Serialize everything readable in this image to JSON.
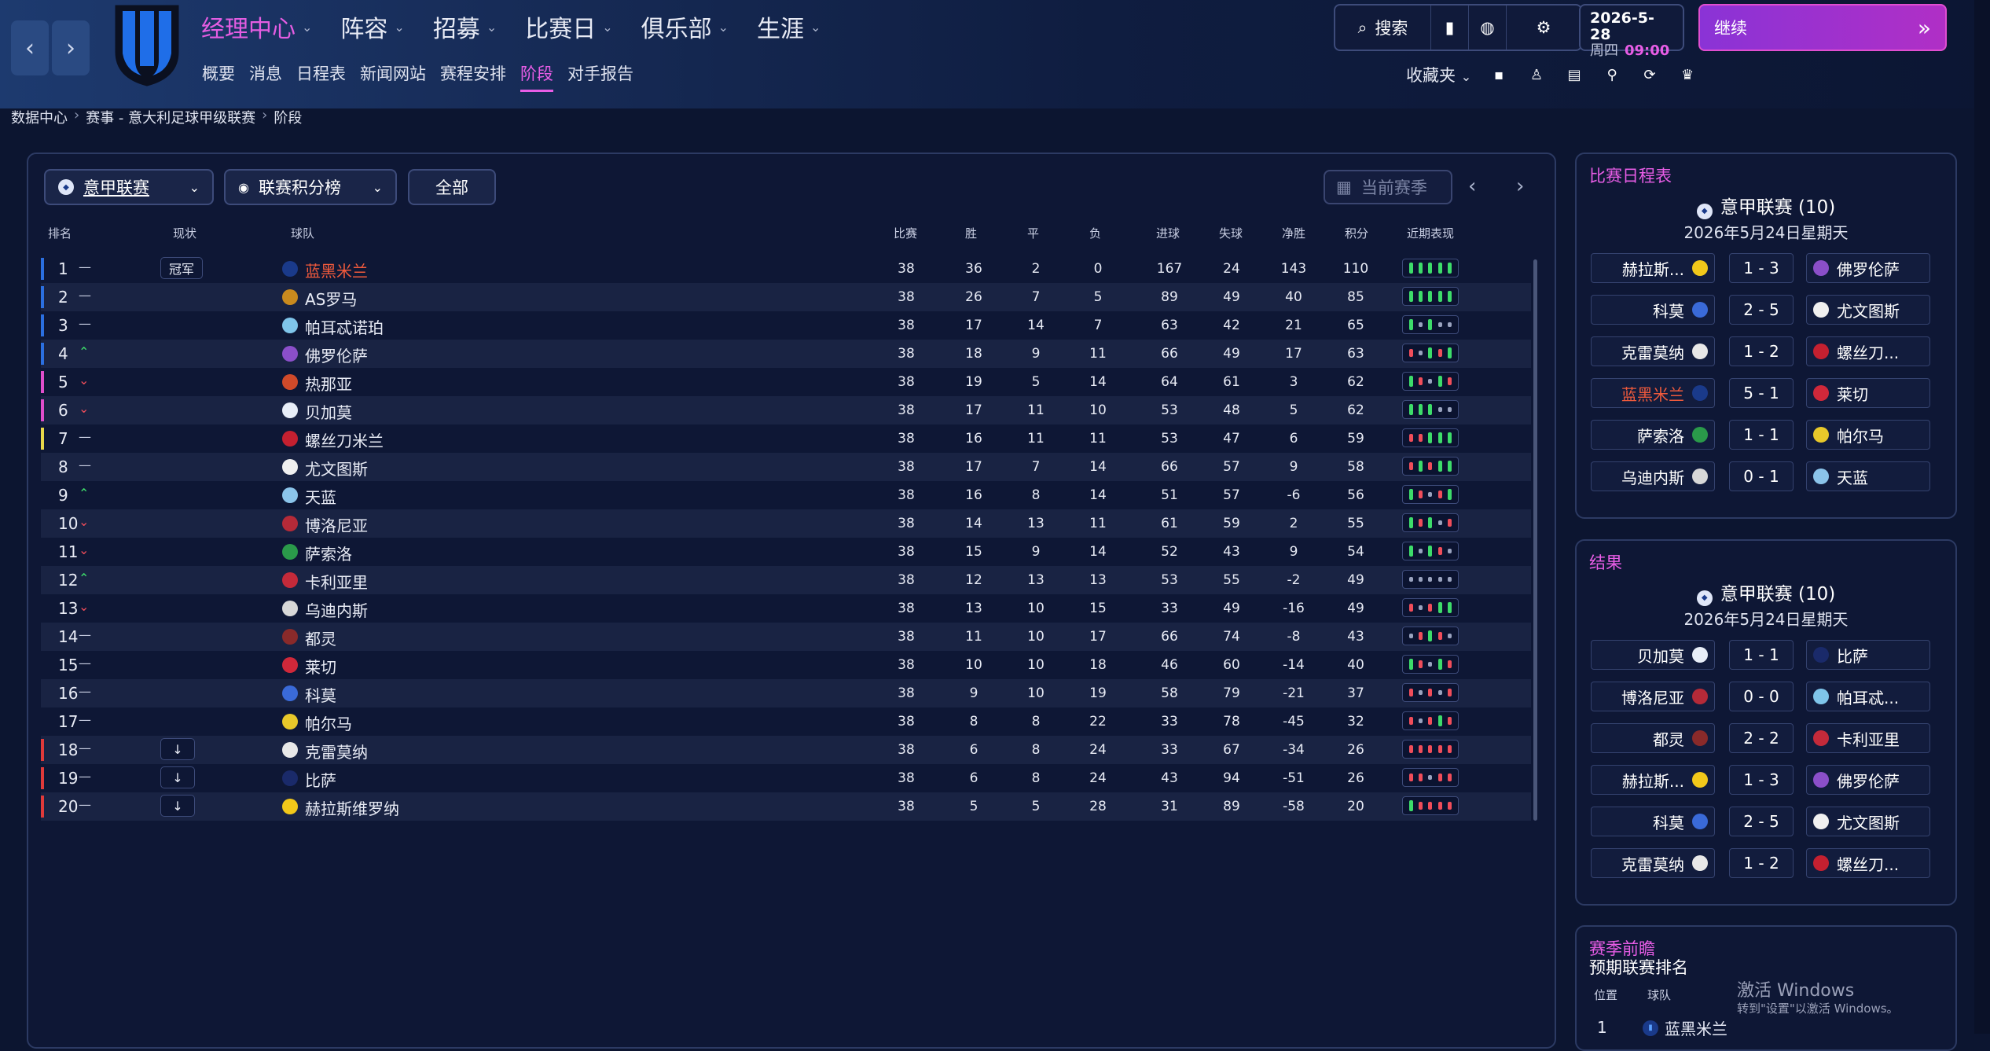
{
  "nav": {
    "back": "‹",
    "forward": "›"
  },
  "menu": [
    {
      "label": "经理中心",
      "active": true
    },
    {
      "label": "阵容"
    },
    {
      "label": "招募"
    },
    {
      "label": "比赛日"
    },
    {
      "label": "俱乐部"
    },
    {
      "label": "生涯"
    }
  ],
  "submenu": [
    "概要",
    "消息",
    "日程表",
    "新闻网站",
    "赛程安排",
    "阶段",
    "对手报告"
  ],
  "header": {
    "search_label": "搜索",
    "date": "2026-5-28",
    "weekday": "周四",
    "time": "09:00",
    "continue_label": "继续",
    "favorites_label": "收藏夹"
  },
  "breadcrumb": [
    "数据中心",
    "赛事 - 意大利足球甲级联赛",
    "阶段"
  ],
  "filters": {
    "competition": "意甲联赛",
    "view": "联赛积分榜",
    "scope": "全部",
    "season": "当前赛季"
  },
  "table": {
    "headers": {
      "rank": "排名",
      "status": "现状",
      "team": "球队",
      "played": "比赛",
      "won": "胜",
      "drawn": "平",
      "lost": "负",
      "gf": "进球",
      "ga": "失球",
      "gd": "净胜",
      "pts": "积分",
      "form": "近期表现"
    },
    "rows": [
      {
        "rank": "1",
        "trend": "same",
        "status": "冠军",
        "team": "蓝黑米兰",
        "p": "38",
        "w": "36",
        "d": "2",
        "l": "0",
        "gf": "167",
        "ga": "24",
        "gd": "143",
        "pts": "110",
        "form": "wwwww",
        "zone": "#2b6fe0",
        "hl": true,
        "badge": "#1a3a8a"
      },
      {
        "rank": "2",
        "trend": "same",
        "status": "",
        "team": "AS罗马",
        "p": "38",
        "w": "26",
        "d": "7",
        "l": "5",
        "gf": "89",
        "ga": "49",
        "gd": "40",
        "pts": "85",
        "form": "wwwww",
        "zone": "#2b6fe0",
        "badge": "#c98a1e"
      },
      {
        "rank": "3",
        "trend": "same",
        "status": "",
        "team": "帕耳忒诺珀",
        "p": "38",
        "w": "17",
        "d": "14",
        "l": "7",
        "gf": "63",
        "ga": "42",
        "gd": "21",
        "pts": "65",
        "form": "wdwdd",
        "zone": "#2b6fe0",
        "badge": "#7fc5ea"
      },
      {
        "rank": "4",
        "trend": "up",
        "status": "",
        "team": "佛罗伦萨",
        "p": "38",
        "w": "18",
        "d": "9",
        "l": "11",
        "gf": "66",
        "ga": "49",
        "gd": "17",
        "pts": "63",
        "form": "ldwlw",
        "zone": "#2b6fe0",
        "badge": "#8b4fc9"
      },
      {
        "rank": "5",
        "trend": "down",
        "status": "",
        "team": "热那亚",
        "p": "38",
        "w": "19",
        "d": "5",
        "l": "14",
        "gf": "64",
        "ga": "61",
        "gd": "3",
        "pts": "62",
        "form": "wldwl",
        "zone": "#e04ecb",
        "badge": "#d04a2a"
      },
      {
        "rank": "6",
        "trend": "down",
        "status": "",
        "team": "贝加莫",
        "p": "38",
        "w": "17",
        "d": "11",
        "l": "10",
        "gf": "53",
        "ga": "48",
        "gd": "5",
        "pts": "62",
        "form": "wwwdd",
        "zone": "#e04ecb",
        "badge": "#e8eef8"
      },
      {
        "rank": "7",
        "trend": "same",
        "status": "",
        "team": "螺丝刀米兰",
        "p": "38",
        "w": "16",
        "d": "11",
        "l": "11",
        "gf": "53",
        "ga": "47",
        "gd": "6",
        "pts": "59",
        "form": "llwww",
        "zone": "#e8d84a",
        "badge": "#c42030"
      },
      {
        "rank": "8",
        "trend": "same",
        "status": "",
        "team": "尤文图斯",
        "p": "38",
        "w": "17",
        "d": "7",
        "l": "14",
        "gf": "66",
        "ga": "57",
        "gd": "9",
        "pts": "58",
        "form": "lwlww",
        "zone": "",
        "badge": "#f0f0f0"
      },
      {
        "rank": "9",
        "trend": "up",
        "status": "",
        "team": "天蓝",
        "p": "38",
        "w": "16",
        "d": "8",
        "l": "14",
        "gf": "51",
        "ga": "57",
        "gd": "-6",
        "pts": "56",
        "form": "wldlw",
        "zone": "",
        "badge": "#8bc4ea"
      },
      {
        "rank": "10",
        "trend": "down",
        "status": "",
        "team": "博洛尼亚",
        "p": "38",
        "w": "14",
        "d": "13",
        "l": "11",
        "gf": "61",
        "ga": "59",
        "gd": "2",
        "pts": "55",
        "form": "wlwdl",
        "zone": "",
        "badge": "#b52a38"
      },
      {
        "rank": "11",
        "trend": "down",
        "status": "",
        "team": "萨索洛",
        "p": "38",
        "w": "15",
        "d": "9",
        "l": "14",
        "gf": "52",
        "ga": "43",
        "gd": "9",
        "pts": "54",
        "form": "wdwld",
        "zone": "",
        "badge": "#2a9a4a"
      },
      {
        "rank": "12",
        "trend": "up",
        "status": "",
        "team": "卡利亚里",
        "p": "38",
        "w": "12",
        "d": "13",
        "l": "13",
        "gf": "53",
        "ga": "55",
        "gd": "-2",
        "pts": "49",
        "form": "ddddd",
        "zone": "",
        "badge": "#c42a3a"
      },
      {
        "rank": "13",
        "trend": "down",
        "status": "",
        "team": "乌迪内斯",
        "p": "38",
        "w": "13",
        "d": "10",
        "l": "15",
        "gf": "33",
        "ga": "49",
        "gd": "-16",
        "pts": "49",
        "form": "ldlww",
        "zone": "",
        "badge": "#d8d8d8"
      },
      {
        "rank": "14",
        "trend": "same",
        "status": "",
        "team": "都灵",
        "p": "38",
        "w": "11",
        "d": "10",
        "l": "17",
        "gf": "66",
        "ga": "74",
        "gd": "-8",
        "pts": "43",
        "form": "dlwld",
        "zone": "",
        "badge": "#8a2a2a"
      },
      {
        "rank": "15",
        "trend": "same",
        "status": "",
        "team": "莱切",
        "p": "38",
        "w": "10",
        "d": "10",
        "l": "18",
        "gf": "46",
        "ga": "60",
        "gd": "-14",
        "pts": "40",
        "form": "wldwl",
        "zone": "",
        "badge": "#d0283a"
      },
      {
        "rank": "16",
        "trend": "same",
        "status": "",
        "team": "科莫",
        "p": "38",
        "w": "9",
        "d": "10",
        "l": "19",
        "gf": "58",
        "ga": "79",
        "gd": "-21",
        "pts": "37",
        "form": "ldldl",
        "zone": "",
        "badge": "#3a6ad8"
      },
      {
        "rank": "17",
        "trend": "same",
        "status": "",
        "team": "帕尔马",
        "p": "38",
        "w": "8",
        "d": "8",
        "l": "22",
        "gf": "33",
        "ga": "78",
        "gd": "-45",
        "pts": "32",
        "form": "ldlwl",
        "zone": "",
        "badge": "#e8c82a"
      },
      {
        "rank": "18",
        "trend": "same",
        "status": "↓",
        "team": "克雷莫纳",
        "p": "38",
        "w": "6",
        "d": "8",
        "l": "24",
        "gf": "33",
        "ga": "67",
        "gd": "-34",
        "pts": "26",
        "form": "lllll",
        "zone": "#e03a3a",
        "badge": "#e8e8e8"
      },
      {
        "rank": "19",
        "trend": "same",
        "status": "↓",
        "team": "比萨",
        "p": "38",
        "w": "6",
        "d": "8",
        "l": "24",
        "gf": "43",
        "ga": "94",
        "gd": "-51",
        "pts": "26",
        "form": "lldll",
        "zone": "#e03a3a",
        "badge": "#1a2a6a"
      },
      {
        "rank": "20",
        "trend": "same",
        "status": "↓",
        "team": "赫拉斯维罗纳",
        "p": "38",
        "w": "5",
        "d": "5",
        "l": "28",
        "gf": "31",
        "ga": "89",
        "gd": "-58",
        "pts": "20",
        "form": "wllll",
        "zone": "#e03a3a",
        "badge": "#f2c81a"
      }
    ]
  },
  "fixtures": {
    "title": "比赛日程表",
    "competition": "意甲联赛",
    "round": "(10)",
    "date": "2026年5月24日星期天",
    "matches": [
      {
        "home": "赫拉斯...",
        "score": "1 - 3",
        "away": "佛罗伦萨",
        "hb": "#f2c81a",
        "ab": "#8b4fc9"
      },
      {
        "home": "科莫",
        "score": "2 - 5",
        "away": "尤文图斯",
        "hb": "#3a6ad8",
        "ab": "#f0f0f0"
      },
      {
        "home": "克雷莫纳",
        "score": "1 - 2",
        "away": "螺丝刀...",
        "hb": "#e8e8e8",
        "ab": "#c42030"
      },
      {
        "home": "蓝黑米兰",
        "score": "5 - 1",
        "away": "莱切",
        "hb": "#1a3a8a",
        "ab": "#d0283a",
        "hl": true
      },
      {
        "home": "萨索洛",
        "score": "1 - 1",
        "away": "帕尔马",
        "hb": "#2a9a4a",
        "ab": "#e8c82a"
      },
      {
        "home": "乌迪内斯",
        "score": "0 - 1",
        "away": "天蓝",
        "hb": "#d8d8d8",
        "ab": "#8bc4ea"
      }
    ]
  },
  "results": {
    "title": "结果",
    "competition": "意甲联赛",
    "round": "(10)",
    "date": "2026年5月24日星期天",
    "matches": [
      {
        "home": "贝加莫",
        "score": "1 - 1",
        "away": "比萨",
        "hb": "#e8eef8",
        "ab": "#1a2a6a"
      },
      {
        "home": "博洛尼亚",
        "score": "0 - 0",
        "away": "帕耳忒...",
        "hb": "#b52a38",
        "ab": "#7fc5ea"
      },
      {
        "home": "都灵",
        "score": "2 - 2",
        "away": "卡利亚里",
        "hb": "#8a2a2a",
        "ab": "#c42a3a"
      },
      {
        "home": "赫拉斯...",
        "score": "1 - 3",
        "away": "佛罗伦萨",
        "hb": "#f2c81a",
        "ab": "#8b4fc9"
      },
      {
        "home": "科莫",
        "score": "2 - 5",
        "away": "尤文图斯",
        "hb": "#3a6ad8",
        "ab": "#f0f0f0"
      },
      {
        "home": "克雷莫纳",
        "score": "1 - 2",
        "away": "螺丝刀...",
        "hb": "#e8e8e8",
        "ab": "#c42030"
      }
    ]
  },
  "preview": {
    "title": "赛季前瞻",
    "subtitle": "预期联赛排名",
    "col_pos": "位置",
    "col_team": "球队",
    "first_pos": "1",
    "first_team": "蓝黑米兰"
  },
  "watermark": {
    "line1": "激活 Windows",
    "line2": "转到\"设置\"以激活 Windows。"
  },
  "colors": {
    "accent": "#e85de6",
    "win": "#3ddc6a",
    "loss": "#f04d5a",
    "draw": "#9aa3bf"
  }
}
